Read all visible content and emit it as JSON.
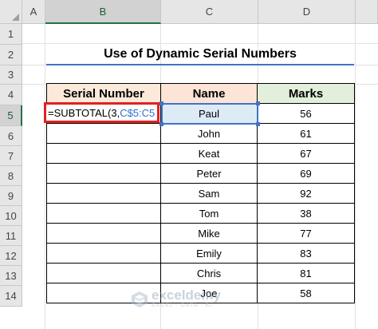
{
  "columns": [
    "A",
    "B",
    "C",
    "D"
  ],
  "rows": [
    "1",
    "2",
    "3",
    "4",
    "5",
    "6",
    "7",
    "8",
    "9",
    "10",
    "11",
    "12",
    "13",
    "14"
  ],
  "active_column": "B",
  "active_row": "5",
  "title": "Use of Dynamic Serial Numbers",
  "table": {
    "headers": {
      "serial": "Serial Number",
      "name": "Name",
      "marks": "Marks"
    },
    "rows": [
      {
        "serial": "",
        "name": "Paul",
        "marks": "56"
      },
      {
        "serial": "",
        "name": "John",
        "marks": "61"
      },
      {
        "serial": "",
        "name": "Keat",
        "marks": "67"
      },
      {
        "serial": "",
        "name": "Peter",
        "marks": "69"
      },
      {
        "serial": "",
        "name": "Sam",
        "marks": "92"
      },
      {
        "serial": "",
        "name": "Tom",
        "marks": "38"
      },
      {
        "serial": "",
        "name": "Mike",
        "marks": "77"
      },
      {
        "serial": "",
        "name": "Emily",
        "marks": "83"
      },
      {
        "serial": "",
        "name": "Chris",
        "marks": "81"
      },
      {
        "serial": "",
        "name": "Joe",
        "marks": "58"
      }
    ]
  },
  "formula": {
    "prefix": "=SUBTOTAL(3,",
    "range": "C$5:C5"
  },
  "watermark": {
    "name": "exceldemy",
    "tagline": "EXCEL · DATA · BI"
  },
  "colors": {
    "accent": "#217346",
    "title_border": "#4472c4",
    "formula_border": "#e32020",
    "range_ref": "#2f6fcf"
  }
}
